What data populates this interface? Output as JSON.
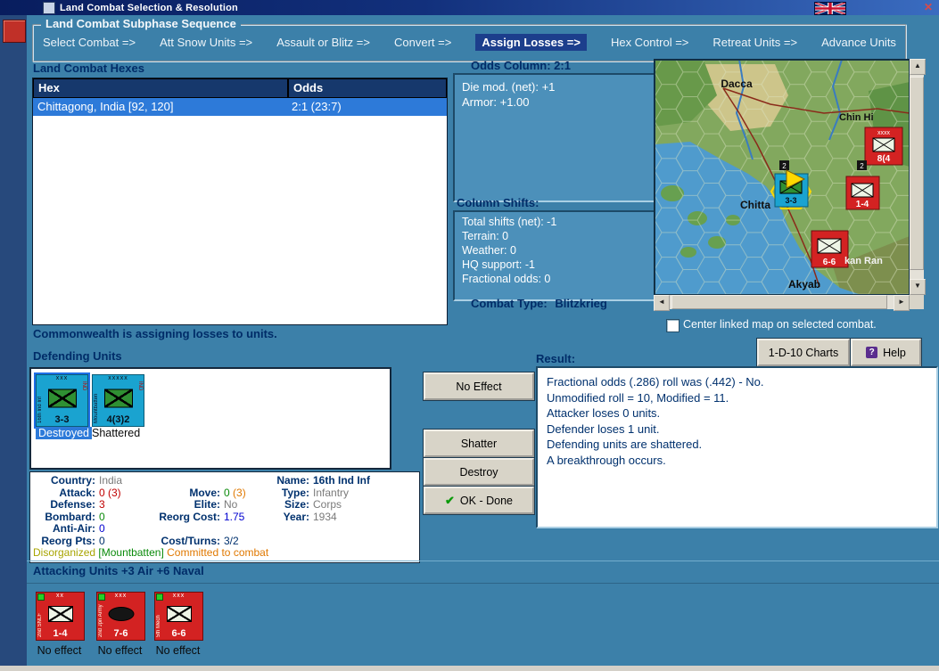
{
  "window": {
    "title": "Land Combat Selection & Resolution"
  },
  "icons": {
    "close": "✕",
    "help": "?",
    "ok_check": "✔",
    "scroll_left": "◄",
    "scroll_right": "►",
    "scroll_up": "▲",
    "scroll_down": "▼"
  },
  "sequence": {
    "legend": "Land Combat Subphase Sequence",
    "steps": [
      {
        "label": "Select Combat =>"
      },
      {
        "label": "Att Snow Units =>"
      },
      {
        "label": "Assault or Blitz =>"
      },
      {
        "label": "Convert =>"
      },
      {
        "label": "Assign Losses =>"
      },
      {
        "label": "Hex Control =>"
      },
      {
        "label": "Retreat Units =>"
      },
      {
        "label": "Advance Units"
      }
    ]
  },
  "hexes_panel": {
    "title": "Land Combat Hexes",
    "columns": [
      "Hex",
      "Odds"
    ],
    "rows": [
      {
        "hex": "Chittagong, India [92, 120]",
        "odds": "2:1 (23:7)"
      }
    ]
  },
  "odds_panel": {
    "title": "Odds Column: 2:1",
    "lines": [
      "Die mod. (net): +1",
      "Armor: +1.00"
    ]
  },
  "shifts_panel": {
    "title": "Column Shifts:",
    "lines": [
      "Total shifts (net): -1",
      "Terrain: 0",
      "Weather: 0",
      "HQ support: -1",
      "Fractional odds: 0"
    ]
  },
  "combat_type": {
    "label": "Combat Type:",
    "value": "Blitzkrieg"
  },
  "map": {
    "labels": {
      "city1": "Dacca",
      "region1": "Chin Hi",
      "city2": "Chitta",
      "city3": "Akyab",
      "region2": "kan Ran"
    },
    "units": {
      "hq_size": "xxxx",
      "hq_strength": "8(4",
      "def_strength": "3-3",
      "atk1_strength": "1-4",
      "atk2_strength": "6-6",
      "stack1": "2",
      "stack2": "2"
    },
    "checkbox_label": "Center linked map on selected combat."
  },
  "toolbar": {
    "charts_button": "1-D-10 Charts",
    "help_button": "Help"
  },
  "status_line": "Commonwealth is assigning losses to units.",
  "defending": {
    "title": "Defending Units",
    "units": [
      {
        "size": "xxx",
        "name": "16th Ind Inf",
        "nat": "IND",
        "strength": "3-3",
        "status": "Destroyed"
      },
      {
        "size": "xxxxx",
        "name": "Mountbatten",
        "nat": "IND",
        "strength": "4(3)2",
        "status": "Shattered"
      }
    ]
  },
  "unit_info": {
    "country_label": "Country:",
    "country": "India",
    "name_label": "Name:",
    "name": "16th Ind Inf",
    "attack_label": "Attack:",
    "attack": "0 (3)",
    "move_label": "Move:",
    "move": "0",
    "move_paren": "(3)",
    "type_label": "Type:",
    "type": "Infantry",
    "defense_label": "Defense:",
    "defense": "3",
    "elite_label": "Elite:",
    "elite": "No",
    "size_label": "Size:",
    "size": "Corps",
    "bombard_label": "Bombard:",
    "bombard": "0",
    "reorg_cost_label": "Reorg Cost:",
    "reorg_cost": "1.75",
    "year_label": "Year:",
    "year": "1934",
    "antiair_label": "Anti-Air:",
    "antiair": "0",
    "reorg_pts_label": "Reorg Pts:",
    "reorg_pts": "0",
    "cost_turns_label": "Cost/Turns:",
    "cost_turns": "3/2",
    "flag_disorganized": "Disorganized",
    "flag_hq": "[Mountbatten]",
    "flag_committed": "Committed to combat"
  },
  "actions": {
    "no_effect": "No Effect",
    "shatter": "Shatter",
    "destroy": "Destroy",
    "ok_done": "OK - Done"
  },
  "result": {
    "title": "Result:",
    "lines": [
      "Fractional odds (.286) roll was (.442)  - No.",
      "Unmodified roll = 10, Modified = 11.",
      "Attacker loses 0 units.",
      "Defender loses 1 unit.",
      "Defending units are shattered.",
      "A breakthrough occurs."
    ]
  },
  "attacking": {
    "title": "Attacking Units +3 Air +6 Naval",
    "units": [
      {
        "size": "xx",
        "name": "2nd SNLF",
        "strength": "1-4",
        "result": "No effect"
      },
      {
        "size": "xxx",
        "name": "2nd Jpn Army",
        "strength": "7-6",
        "result": "No effect"
      },
      {
        "size": "xxx",
        "name": "5th Mech",
        "strength": "6-6",
        "result": "No effect"
      }
    ]
  }
}
